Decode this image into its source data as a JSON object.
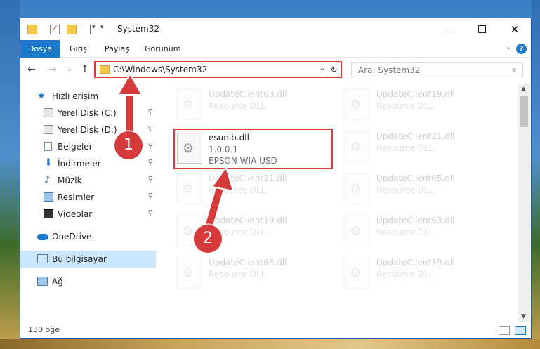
{
  "window": {
    "title": "System32",
    "min_symbol": "",
    "close_symbol": "✕"
  },
  "ribbon": {
    "tabs": [
      "Dosya",
      "Giriş",
      "Paylaş",
      "Görünüm"
    ],
    "expand_symbol": "⌄",
    "help_symbol": "?"
  },
  "nav": {
    "back_symbol": "←",
    "forward_symbol": "→",
    "recent_symbol": "⌄",
    "up_symbol": "↑",
    "address_path": "C:\\Windows\\System32",
    "address_dropdown_symbol": "⌄",
    "refresh_symbol": "↻",
    "search_placeholder": "Ara: System32",
    "search_symbol": "⌕"
  },
  "sidebar": {
    "items": [
      {
        "label": "Hızlı erişim",
        "icon": "star-icon",
        "pinned": false
      },
      {
        "label": "Yerel Disk (C:)",
        "icon": "disk-icon",
        "pinned": true
      },
      {
        "label": "Yerel Disk (D:)",
        "icon": "disk-icon",
        "pinned": true
      },
      {
        "label": "Belgeler",
        "icon": "documents-icon",
        "pinned": true
      },
      {
        "label": "İndirmeler",
        "icon": "download-icon",
        "pinned": true
      },
      {
        "label": "Müzik",
        "icon": "music-icon",
        "pinned": true
      },
      {
        "label": "Resimler",
        "icon": "pictures-icon",
        "pinned": true
      },
      {
        "label": "Videolar",
        "icon": "videos-icon",
        "pinned": true
      },
      {
        "label": "OneDrive",
        "icon": "cloud-icon",
        "pinned": false
      },
      {
        "label": "Bu bilgisayar",
        "icon": "computer-icon",
        "pinned": false,
        "selected": true
      },
      {
        "label": "Ağ",
        "icon": "network-icon",
        "pinned": false
      }
    ],
    "pin_symbol": "📌"
  },
  "files": [
    {
      "name": "UpdateClient63.dll",
      "type": "Resource DLL",
      "faded": true
    },
    {
      "name": "UpdateClient19.dll",
      "type": "Resource DLL",
      "faded": true
    },
    {
      "name": "esunib.dll",
      "version": "1.0.0.1",
      "description": "EPSON WIA USD",
      "faded": false,
      "highlighted": true
    },
    {
      "name": "UpdateClient21.dll",
      "type": "Resource DLL",
      "faded": true
    },
    {
      "name": "UpdateClient21.dll",
      "type": "Resource DLL",
      "faded": true
    },
    {
      "name": "UpdateClient65.dll",
      "type": "Resource DLL",
      "faded": true
    },
    {
      "name": "UpdateClient19.dll",
      "type": "Resource DLL",
      "faded": true
    },
    {
      "name": "UpdateClient63.dll",
      "type": "Resource DLL",
      "faded": true
    },
    {
      "name": "UpdateClient65.dll",
      "type": "Resource DLL",
      "faded": true
    },
    {
      "name": "UpdateClient19.dll",
      "type": "Resource DLL",
      "faded": true
    }
  ],
  "scrollbar": {
    "up_symbol": "▲",
    "down_symbol": "▼",
    "position_fraction": 0.0
  },
  "status": {
    "item_count": "130 öğe"
  },
  "annotations": {
    "step1": "1",
    "step2": "2",
    "color": "#d73a3a"
  },
  "colors": {
    "accent": "#1979ca",
    "selection": "#cce8ff",
    "highlight": "#d73a3a"
  }
}
